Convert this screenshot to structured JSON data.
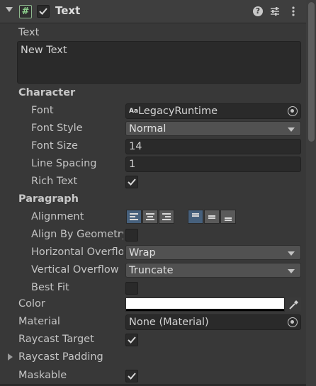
{
  "header": {
    "title": "Text",
    "enabled": true,
    "icons": [
      "script-icon",
      "help-icon",
      "preset-icon",
      "menu-icon"
    ]
  },
  "text_section": {
    "label": "Text",
    "value": "New Text"
  },
  "character": {
    "heading": "Character",
    "font": {
      "label": "Font",
      "value": "LegacyRuntime",
      "icon_glyph": "Aa"
    },
    "font_style": {
      "label": "Font Style",
      "value": "Normal"
    },
    "font_size": {
      "label": "Font Size",
      "value": "14"
    },
    "line_spacing": {
      "label": "Line Spacing",
      "value": "1"
    },
    "rich_text": {
      "label": "Rich Text",
      "checked": true
    }
  },
  "paragraph": {
    "heading": "Paragraph",
    "alignment": {
      "label": "Alignment",
      "horizontal_selected": "left",
      "vertical_selected": "top"
    },
    "align_by_geometry": {
      "label": "Align By Geometry",
      "checked": false
    },
    "horizontal_overflow": {
      "label": "Horizontal Overflow",
      "value": "Wrap"
    },
    "vertical_overflow": {
      "label": "Vertical Overflow",
      "value": "Truncate"
    },
    "best_fit": {
      "label": "Best Fit",
      "checked": false
    }
  },
  "color": {
    "label": "Color",
    "value": "#FFFFFF"
  },
  "material": {
    "label": "Material",
    "value": "None (Material)"
  },
  "raycast_target": {
    "label": "Raycast Target",
    "checked": true
  },
  "raycast_padding": {
    "label": "Raycast Padding",
    "expanded": false
  },
  "maskable": {
    "label": "Maskable",
    "checked": true
  }
}
